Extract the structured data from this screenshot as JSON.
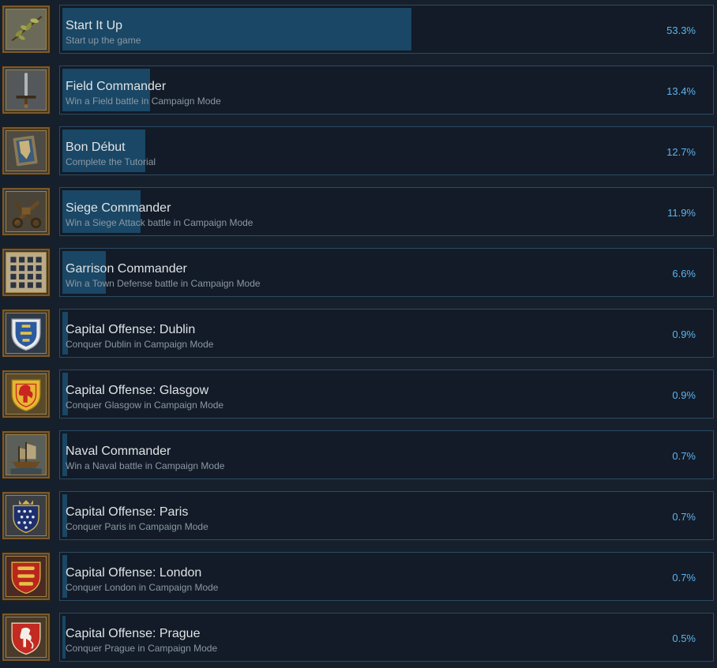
{
  "achievements": [
    {
      "name": "Start It Up",
      "description": "Start up the game",
      "percent": "53.3%",
      "unlocked_fraction": 0.533,
      "icon": "olive-branch-icon"
    },
    {
      "name": "Field Commander",
      "description": "Win a Field battle in Campaign Mode",
      "percent": "13.4%",
      "unlocked_fraction": 0.134,
      "icon": "sword-icon"
    },
    {
      "name": "Bon Début",
      "description": "Complete the Tutorial",
      "percent": "12.7%",
      "unlocked_fraction": 0.127,
      "icon": "shield-book-icon"
    },
    {
      "name": "Siege Commander",
      "description": "Win a Siege Attack battle in Campaign Mode",
      "percent": "11.9%",
      "unlocked_fraction": 0.119,
      "icon": "siege-engine-icon"
    },
    {
      "name": "Garrison Commander",
      "description": "Win a Town Defense battle in Campaign Mode",
      "percent": "6.6%",
      "unlocked_fraction": 0.066,
      "icon": "portcullis-icon"
    },
    {
      "name": "Capital Offense: Dublin",
      "description": "Conquer Dublin in Campaign Mode",
      "percent": "0.9%",
      "unlocked_fraction": 0.009,
      "icon": "dublin-crest-icon"
    },
    {
      "name": "Capital Offense: Glasgow",
      "description": "Conquer Glasgow in Campaign Mode",
      "percent": "0.9%",
      "unlocked_fraction": 0.009,
      "icon": "glasgow-crest-icon"
    },
    {
      "name": "Naval Commander",
      "description": "Win a Naval battle in Campaign Mode",
      "percent": "0.7%",
      "unlocked_fraction": 0.007,
      "icon": "ship-icon"
    },
    {
      "name": "Capital Offense: Paris",
      "description": "Conquer Paris in Campaign Mode",
      "percent": "0.7%",
      "unlocked_fraction": 0.007,
      "icon": "paris-crest-icon"
    },
    {
      "name": "Capital Offense: London",
      "description": "Conquer London in Campaign Mode",
      "percent": "0.7%",
      "unlocked_fraction": 0.007,
      "icon": "london-crest-icon"
    },
    {
      "name": "Capital Offense: Prague",
      "description": "Conquer Prague in Campaign Mode",
      "percent": "0.5%",
      "unlocked_fraction": 0.005,
      "icon": "prague-crest-icon"
    }
  ],
  "colors": {
    "background": "#16202d",
    "panel_border": "#2d4a63",
    "progress_fill": "#1a4765",
    "percent_text": "#5db3f0",
    "title_text": "#dfe3e6",
    "description_text": "#8c98a4",
    "icon_frame": "#7a5a2c"
  }
}
